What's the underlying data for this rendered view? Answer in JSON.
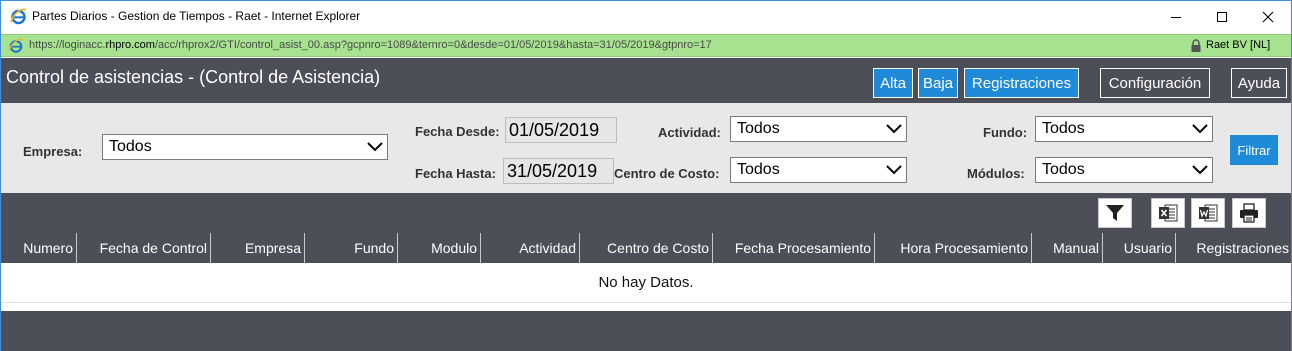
{
  "window": {
    "title": "Partes Diarios - Gestion de Tiempos - Raet - Internet Explorer"
  },
  "address": {
    "url_prefix": "https://loginacc.",
    "url_domain": "rhpro.com",
    "url_rest": "/acc/rhprox2/GTI/control_asist_00.asp?gcpnro=1089&ternro=0&desde=01/05/2019&hasta=31/05/2019&gtpnro=17",
    "cert": "Raet BV [NL]"
  },
  "header": {
    "title": "Control de asistencias - (Control de Asistencia)",
    "buttons": {
      "alta": "Alta",
      "baja": "Baja",
      "registraciones": "Registraciones",
      "configuracion": "Configuración",
      "ayuda": "Ayuda"
    }
  },
  "filters": {
    "empresa_label": "Empresa:",
    "empresa_value": "Todos",
    "fecha_desde_label": "Fecha Desde:",
    "fecha_desde_value": "01/05/2019",
    "fecha_hasta_label": "Fecha Hasta:",
    "fecha_hasta_value": "31/05/2019",
    "actividad_label": "Actividad:",
    "actividad_value": "Todos",
    "centro_costo_label": "Centro de Costo:",
    "centro_costo_value": "Todos",
    "fundo_label": "Fundo:",
    "fundo_value": "Todos",
    "modulos_label": "Módulos:",
    "modulos_value": "Todos",
    "filtrar_label": "Filtrar"
  },
  "toolbar": {
    "icons": [
      "filter-icon",
      "excel-icon",
      "word-icon",
      "print-icon"
    ]
  },
  "table": {
    "columns": [
      "Numero",
      "Fecha de Control",
      "Empresa",
      "Fundo",
      "Modulo",
      "Actividad",
      "Centro de Costo",
      "Fecha Procesamiento",
      "Hora Procesamiento",
      "Manual",
      "Usuario",
      "Registraciones"
    ],
    "empty_message": "No hay Datos."
  },
  "colors": {
    "header_bg": "#4c4f58",
    "accent_blue": "#1e8ad8",
    "address_green": "#a6e28f",
    "filter_bg": "#e8e8e8"
  }
}
